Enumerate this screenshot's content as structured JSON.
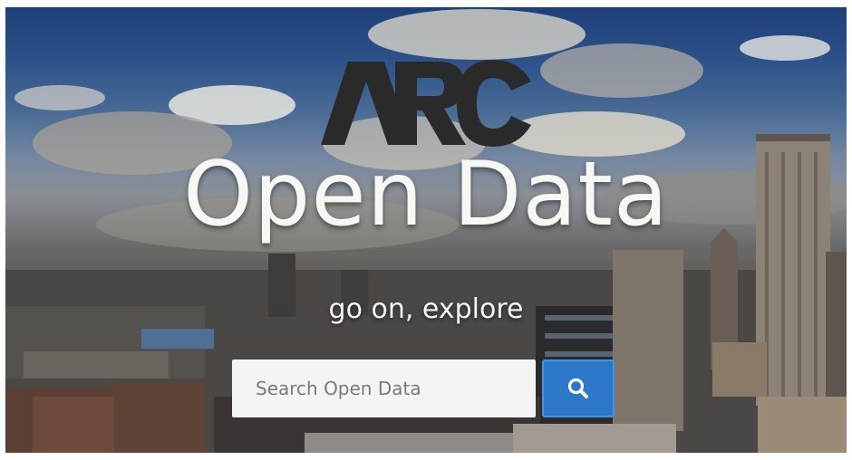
{
  "hero": {
    "logo_text": "ARC",
    "title": "Open Data",
    "tagline": "go on, explore"
  },
  "search": {
    "placeholder": "Search Open Data",
    "button_icon": "search-icon"
  },
  "colors": {
    "search_button": "#2c77c8",
    "title_text": "#f7f7f4",
    "logo": "#2a2a2a"
  }
}
